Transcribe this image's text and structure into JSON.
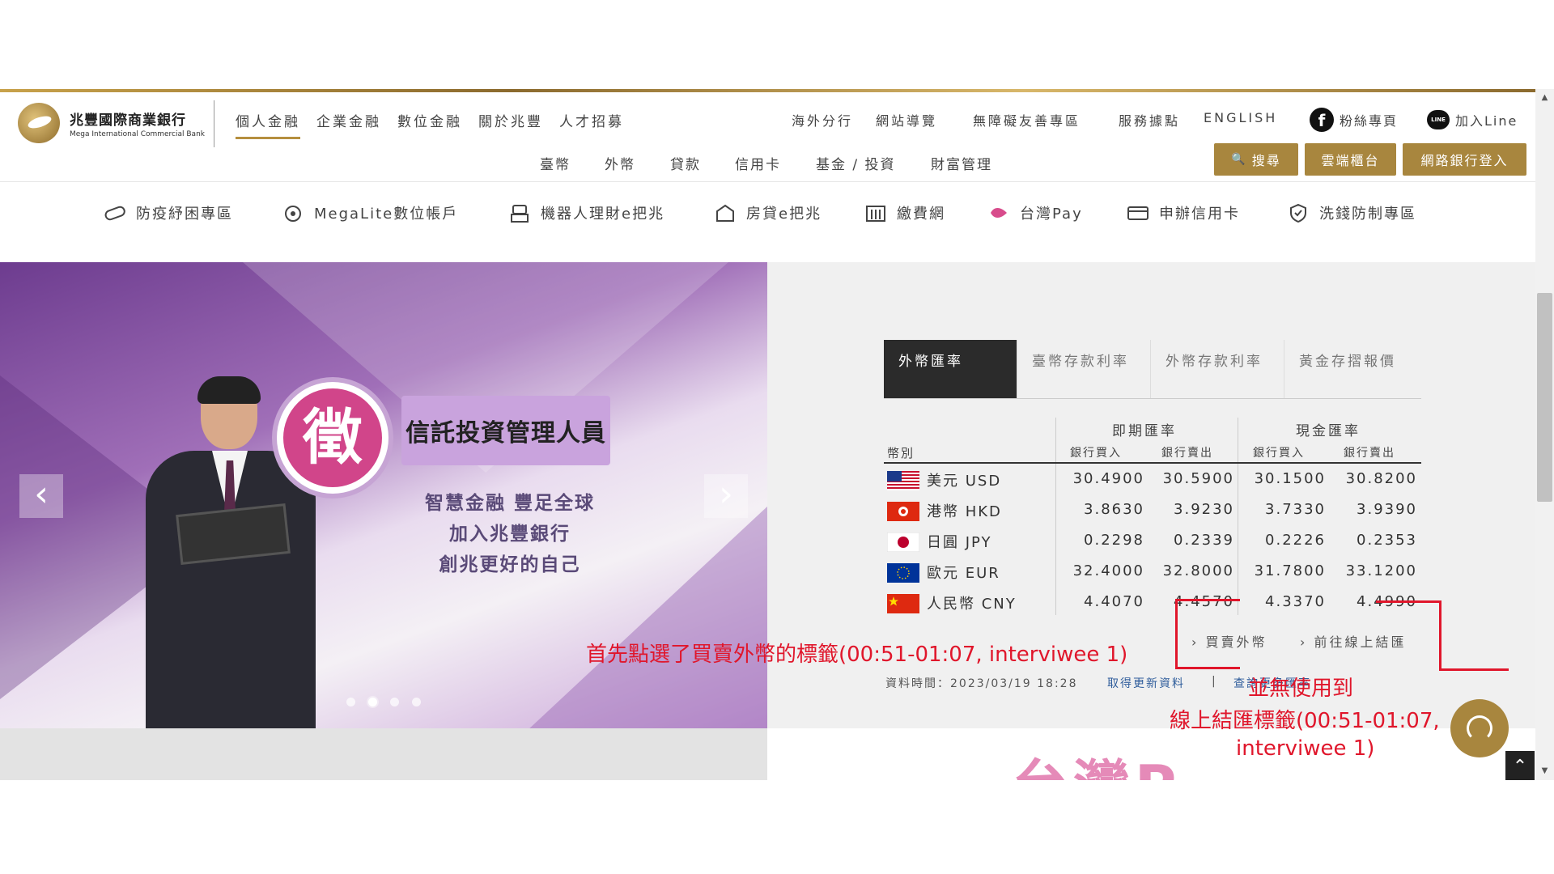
{
  "header": {
    "logo_cn": "兆豐國際商業銀行",
    "logo_en": "Mega International Commercial Bank",
    "main_nav": [
      "個人金融",
      "企業金融",
      "數位金融",
      "關於兆豐",
      "人才招募"
    ],
    "utility_nav": [
      "海外分行",
      "網站導覽",
      "無障礙友善專區",
      "服務據點",
      "ENGLISH"
    ],
    "fans_page": "粉絲專頁",
    "join_line": "加入Line",
    "sub_nav": [
      "臺幣",
      "外幣",
      "貸款",
      "信用卡",
      "基金 / 投資",
      "財富管理"
    ],
    "search_btn": "搜尋",
    "cloud_btn": "雲端櫃台",
    "ebank_btn": "網路銀行登入"
  },
  "quick_links": [
    "防疫紓困專區",
    "MegaLite數位帳戶",
    "機器人理財e把兆",
    "房貸e把兆",
    "繳費網",
    "台灣Pay",
    "申辦信用卡",
    "洗錢防制專區"
  ],
  "banner": {
    "badge_char": "徵",
    "title": "信託投資管理人員",
    "slogan": [
      "智慧金融 豐足全球",
      "加入兆豐銀行",
      "創兆更好的自己"
    ],
    "bottom_text": "台灣P"
  },
  "rates": {
    "tabs": [
      "外幣匯率",
      "臺幣存款利率",
      "外幣存款利率",
      "黃金存摺報價"
    ],
    "col_currency": "幣別",
    "group_spot": "即期匯率",
    "group_cash": "現金匯率",
    "sub_buy": "銀行買入",
    "sub_sell": "銀行賣出",
    "rows": [
      {
        "flag": "us",
        "name": "美元 USD",
        "spot_buy": "30.4900",
        "spot_sell": "30.5900",
        "cash_buy": "30.1500",
        "cash_sell": "30.8200"
      },
      {
        "flag": "hk",
        "name": "港幣 HKD",
        "spot_buy": "3.8630",
        "spot_sell": "3.9230",
        "cash_buy": "3.7330",
        "cash_sell": "3.9390"
      },
      {
        "flag": "jp",
        "name": "日圓 JPY",
        "spot_buy": "0.2298",
        "spot_sell": "0.2339",
        "cash_buy": "0.2226",
        "cash_sell": "0.2353"
      },
      {
        "flag": "eu",
        "name": "歐元 EUR",
        "spot_buy": "32.4000",
        "spot_sell": "32.8000",
        "cash_buy": "31.7800",
        "cash_sell": "33.1200"
      },
      {
        "flag": "cn",
        "name": "人民幣 CNY",
        "spot_buy": "4.4070",
        "spot_sell": "4.4570",
        "cash_buy": "4.3370",
        "cash_sell": "4.4990"
      }
    ],
    "link_buy": "買賣外幣",
    "link_online": "前往線上結匯",
    "data_time_label": "資料時間：2023/03/19 18:28",
    "refresh": "取得更新資料",
    "query": "查詢更多匯率"
  },
  "annotations": {
    "first": "首先點選了買賣外幣的標籤(00:51-01:07, interviwee  1)",
    "second_l1": "並無使用到",
    "second_l2": "線上結匯標籤(00:51-01:07,",
    "second_l3": "interviwee 1)"
  },
  "colors": {
    "gold": "#a8863e",
    "annotation_red": "#e0162b",
    "tab_active": "#2b2b2b",
    "link_blue": "#2f5d9b"
  }
}
